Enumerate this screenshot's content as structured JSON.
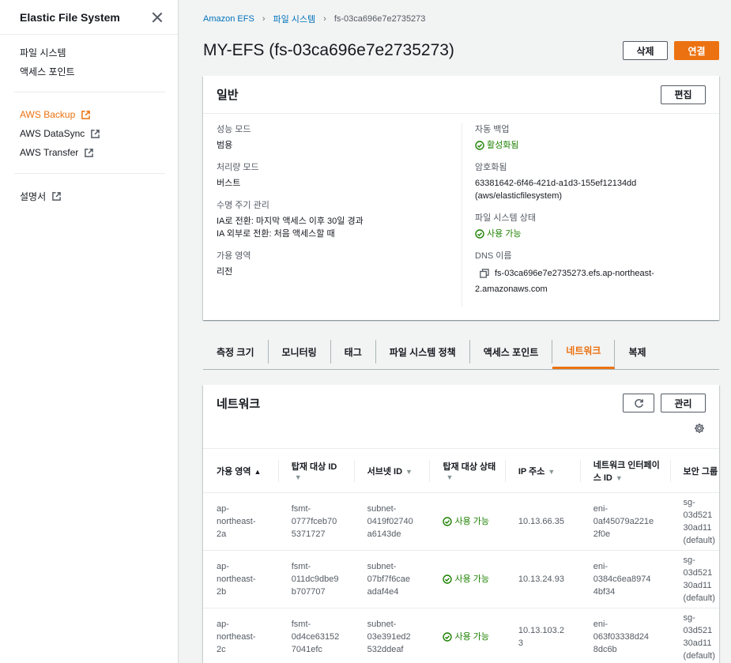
{
  "sidebar": {
    "title": "Elastic File System",
    "items": [
      {
        "label": "파일 시스템"
      },
      {
        "label": "액세스 포인트"
      }
    ],
    "services": [
      {
        "label": "AWS Backup",
        "active": true
      },
      {
        "label": "AWS DataSync",
        "active": false
      },
      {
        "label": "AWS Transfer",
        "active": false
      }
    ],
    "docs_label": "설명서"
  },
  "breadcrumb": {
    "items": [
      "Amazon EFS",
      "파일 시스템"
    ],
    "current": "fs-03ca696e7e2735273"
  },
  "page": {
    "title": "MY-EFS (fs-03ca696e7e2735273)",
    "delete_label": "삭제",
    "connect_label": "연결"
  },
  "general": {
    "title": "일반",
    "edit_label": "편집",
    "left": [
      {
        "key": "성능 모드",
        "value": "범용"
      },
      {
        "key": "처리량 모드",
        "value": "버스트"
      },
      {
        "key": "수명 주기 관리",
        "value": "IA로 전환: 마지막 액세스 이후 30일 경과",
        "value2": "IA 외부로 전환: 처음 액세스할 때"
      },
      {
        "key": "가용 영역",
        "value": "리전"
      }
    ],
    "backup": {
      "key": "자동 백업",
      "value": "활성화됨"
    },
    "encryption": {
      "key": "암호화됨",
      "value": "63381642-6f46-421d-a1d3-155ef12134dd",
      "value2": "(aws/elasticfilesystem)"
    },
    "state": {
      "key": "파일 시스템 상태",
      "value": "사용 가능"
    },
    "dns": {
      "key": "DNS 이름",
      "value": "fs-03ca696e7e2735273.efs.ap-northeast-",
      "value2": "2.amazonaws.com"
    }
  },
  "tabs": [
    "측정 크기",
    "모니터링",
    "태그",
    "파일 시스템 정책",
    "액세스 포인트",
    "네트워크",
    "복제"
  ],
  "active_tab": "네트워크",
  "network": {
    "title": "네트워크",
    "manage_label": "관리",
    "columns": [
      {
        "label": "가용 영역",
        "sort": "▲"
      },
      {
        "label": "탑재 대상 ID",
        "sort": "▼"
      },
      {
        "label": "서브넷 ID",
        "sort": "▼"
      },
      {
        "label": "탑재 대상 상태",
        "sort": "▼"
      },
      {
        "label": "IP 주소",
        "sort": "▼"
      },
      {
        "label": "네트워크 인터페이스 ID",
        "sort": "▼"
      },
      {
        "label": "보안 그룹",
        "sort": ""
      }
    ],
    "rows": [
      {
        "az": [
          "ap-",
          "northeast-",
          "2a"
        ],
        "mt": [
          "fsmt-",
          "0777fceb70",
          "5371727"
        ],
        "subnet": [
          "subnet-",
          "0419f02740",
          "a6143de"
        ],
        "status": "사용 가능",
        "ip": [
          "10.13.66.35"
        ],
        "eni": [
          "eni-",
          "0af45079a221e",
          "2f0e"
        ],
        "sg": [
          "sg-",
          "03d521",
          "30ad11",
          "(default)"
        ]
      },
      {
        "az": [
          "ap-",
          "northeast-",
          "2b"
        ],
        "mt": [
          "fsmt-",
          "011dc9dbe9",
          "b707707"
        ],
        "subnet": [
          "subnet-",
          "07bf7f6cae",
          "adaf4e4"
        ],
        "status": "사용 가능",
        "ip": [
          "10.13.24.93"
        ],
        "eni": [
          "eni-",
          "0384c6ea8974",
          "4bf34"
        ],
        "sg": [
          "sg-",
          "03d521",
          "30ad11",
          "(default)"
        ]
      },
      {
        "az": [
          "ap-",
          "northeast-",
          "2c"
        ],
        "mt": [
          "fsmt-",
          "0d4ce63152",
          "7041efc"
        ],
        "subnet": [
          "subnet-",
          "03e391ed2",
          "532ddeaf"
        ],
        "status": "사용 가능",
        "ip": [
          "10.13.103.2",
          "3"
        ],
        "eni": [
          "eni-",
          "063f03338d24",
          "8dc6b"
        ],
        "sg": [
          "sg-",
          "03d521",
          "30ad11",
          "(default)"
        ]
      }
    ]
  },
  "colors": {
    "accent": "#ec7211",
    "link": "#0073bb",
    "success": "#1d8102"
  }
}
